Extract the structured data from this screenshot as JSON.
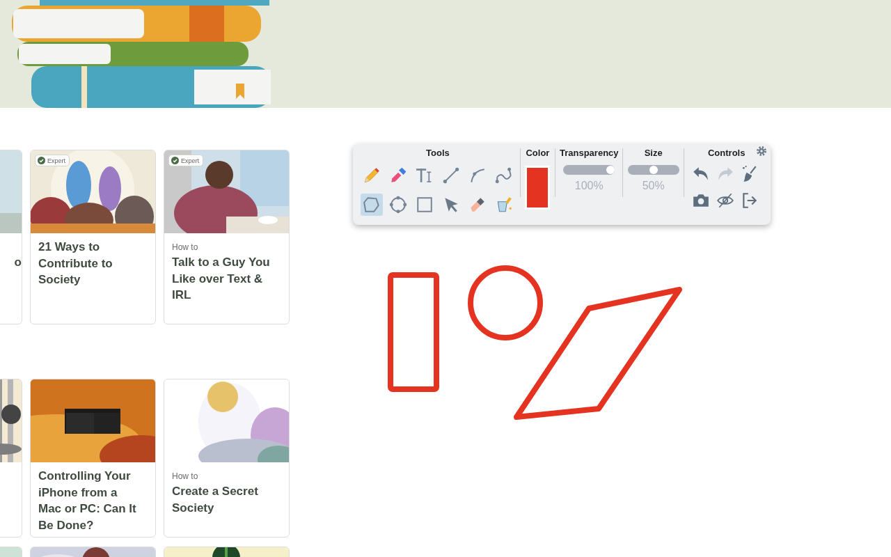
{
  "toolbar": {
    "tools_label": "Tools",
    "tools": [
      {
        "kind": "pencil",
        "selected": false
      },
      {
        "kind": "eyedropper",
        "selected": false
      },
      {
        "kind": "text",
        "selected": false
      },
      {
        "kind": "line",
        "selected": false
      },
      {
        "kind": "curve",
        "selected": false
      },
      {
        "kind": "bezier",
        "selected": false
      },
      {
        "kind": "polygon",
        "selected": true
      },
      {
        "kind": "circle",
        "selected": false
      },
      {
        "kind": "rectangle",
        "selected": false
      },
      {
        "kind": "pointer",
        "selected": false
      },
      {
        "kind": "eraser",
        "selected": false
      },
      {
        "kind": "bucket",
        "selected": false
      }
    ],
    "color_label": "Color",
    "color": "#e53322",
    "transparency": {
      "label": "Transparency",
      "level": 1,
      "reading": "100%"
    },
    "size": {
      "label": "Size",
      "level": 0.5,
      "reading": "50%"
    },
    "controls_label": "Controls",
    "controls": [
      {
        "kind": "undo",
        "disabled": false
      },
      {
        "kind": "redo",
        "disabled": true
      },
      {
        "kind": "clear",
        "disabled": false
      },
      {
        "kind": "camera",
        "disabled": false
      },
      {
        "kind": "hide",
        "disabled": false
      },
      {
        "kind": "exit",
        "disabled": false
      }
    ]
  },
  "drawing": {
    "shapes": [
      {
        "kind": "rectangle"
      },
      {
        "kind": "circle"
      },
      {
        "kind": "polygon"
      }
    ]
  },
  "card_rows": [
    [
      {
        "kind": "article",
        "title": "o"
      },
      {
        "kind": "article",
        "badge": "Expert",
        "title": "21 Ways to Contribute to Society"
      },
      {
        "kind": "article",
        "badge": "Expert",
        "prefix": "How to",
        "title": "Talk to a Guy You Like over Text & IRL"
      }
    ],
    [
      {
        "kind": "picture"
      },
      {
        "kind": "article",
        "title": "Controlling Your iPhone from a Mac or PC: Can It Be Done?"
      },
      {
        "kind": "article",
        "prefix": "How to",
        "title": "Create a Secret Society"
      }
    ],
    [
      {
        "kind": "picture"
      },
      {
        "kind": "picture"
      },
      {
        "kind": "picture"
      }
    ]
  ]
}
